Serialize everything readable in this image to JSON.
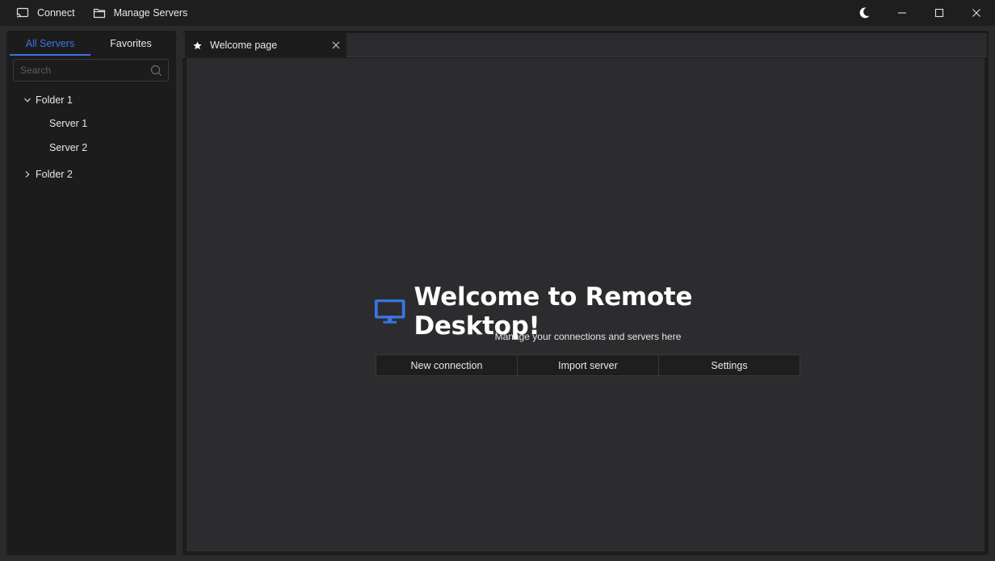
{
  "titlebar": {
    "connect_label": "Connect",
    "manage_label": "Manage Servers"
  },
  "sidebar": {
    "tabs": [
      "All Servers",
      "Favorites"
    ],
    "active_tab": "All Servers",
    "search_placeholder": "Search",
    "tree": [
      {
        "label": "Folder 1",
        "expanded": true,
        "children": [
          "Server 1",
          "Server 2"
        ]
      },
      {
        "label": "Folder 2",
        "expanded": false,
        "children": []
      }
    ]
  },
  "tabs": [
    {
      "label": "Welcome page",
      "icon": "star-icon"
    }
  ],
  "welcome": {
    "title": "Welcome to Remote Desktop!",
    "subtitle": "Manage your connections and servers here",
    "actions": [
      "New connection",
      "Import server",
      "Settings"
    ]
  },
  "colors": {
    "accent": "#3a74e6",
    "background": "#2b2b2d",
    "panel": "#1c1c1d"
  }
}
